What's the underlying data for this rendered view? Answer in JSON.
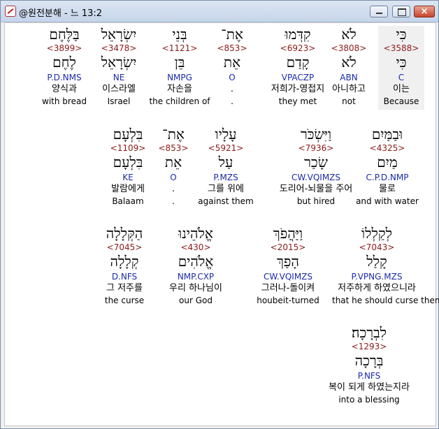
{
  "window": {
    "title": "@원전분해 - 느 13:2",
    "minimize_label": "",
    "maximize_label": "",
    "close_label": "×"
  },
  "rows": [
    [
      {
        "heb": "כִּי",
        "num": "<3588>",
        "lex": "כִּי",
        "parse": "C",
        "kor": "이는",
        "eng": "Because",
        "selected": true
      },
      {
        "heb": "לֹא",
        "num": "<3808>",
        "lex": "לֹא",
        "parse": "ABN",
        "kor": "아니하고",
        "eng": "not"
      },
      {
        "heb": "קִדְּמוּ",
        "num": "<6923>",
        "lex": "קָדַם",
        "parse": "VPACZP",
        "kor": "저희가-영접지",
        "eng": "they met"
      },
      {
        "heb": "אֶת־",
        "num": "<853>",
        "lex": "אֵת",
        "parse": "O",
        "kor": ".",
        "eng": "."
      },
      {
        "heb": "בְּנֵי",
        "num": "<1121>",
        "lex": "בֵּן",
        "parse": "NMPG",
        "kor": "자손을",
        "eng": "the children of"
      },
      {
        "heb": "יִשְׂרָאֵל",
        "num": "<3478>",
        "lex": "יִשְׂרָאֵל",
        "parse": "NE",
        "kor": "이스라엘",
        "eng": "Israel"
      },
      {
        "heb": "בַּלֶּחֶם",
        "num": "<3899>",
        "lex": "לֶחֶם",
        "parse": "P.D.NMS",
        "kor": "양식과",
        "eng": "with bread"
      }
    ],
    [
      {
        "heb": "וּבַמַּיִם",
        "num": "<4325>",
        "lex": "מַיִם",
        "parse": "C.P.D.NMP",
        "kor": "물로",
        "eng": "and with water"
      },
      {
        "heb": "וַיִּשְׂכֹּר",
        "num": "<7936>",
        "lex": "שָׂכַר",
        "parse": "CW.VQIMZS",
        "kor": "도리어-뇌물을 주어",
        "eng": "but hired"
      },
      {
        "heb": "עָלָיו",
        "num": "<5921>",
        "lex": "עַל",
        "parse": "P.MZS",
        "kor": "그를 위에",
        "eng": "against them"
      },
      {
        "heb": "אֶת־",
        "num": "<853>",
        "lex": "אֵת",
        "parse": "O",
        "kor": ".",
        "eng": "."
      },
      {
        "heb": "בִּלְעָם",
        "num": "<1109>",
        "lex": "בִּלְעָם",
        "parse": "KE",
        "kor": "발람에게",
        "eng": "Balaam"
      }
    ],
    [
      {
        "heb": "לְקַלְלוֹ",
        "num": "<7043>",
        "lex": "קָלַל",
        "parse": "P.VPNG.MZS",
        "kor": "저주하게 하였으니라",
        "eng": "that he should curse them"
      },
      {
        "heb": "וַיַּהֲפֹךְ",
        "num": "<2015>",
        "lex": "הָפַךְ",
        "parse": "CW.VQIMZS",
        "kor": "그러나-돌이켜",
        "eng": "houbeit-turned"
      },
      {
        "heb": "אֱלֹהֵינוּ",
        "num": "<430>",
        "lex": "אֱלֹהִים",
        "parse": "NMP.CXP",
        "kor": "우리 하나님이",
        "eng": "our God"
      },
      {
        "heb": "הַקְּלָלָה",
        "num": "<7045>",
        "lex": "קְלָלָה",
        "parse": "D.NFS",
        "kor": "그 저주를",
        "eng": "the curse"
      }
    ],
    [
      {
        "heb": "לִבְרָכָה׃",
        "num": "<1293>",
        "lex": "בְּרָכָה",
        "parse": "P.NFS",
        "kor": "복이 되게 하였는지라",
        "eng": "into a blessing"
      }
    ]
  ]
}
